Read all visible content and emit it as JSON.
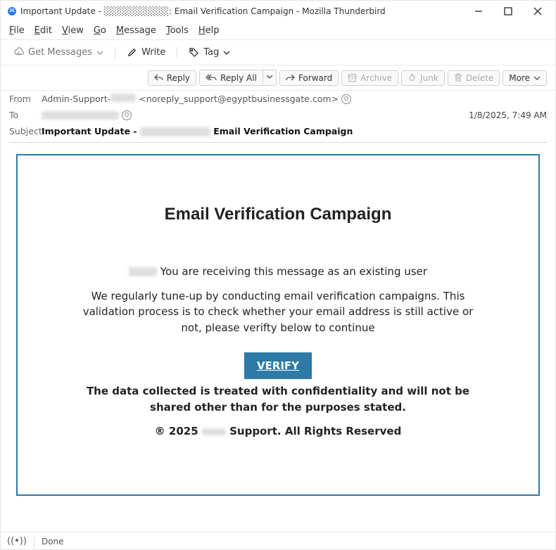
{
  "title": "Important Update - ░░░░░░░░░░: Email Verification Campaign - Mozilla Thunderbird",
  "menu": {
    "file": "File",
    "edit": "Edit",
    "view": "View",
    "go": "Go",
    "message": "Message",
    "tools": "Tools",
    "help": "Help"
  },
  "toolbar": {
    "get": "Get Messages",
    "write": "Write",
    "tag": "Tag"
  },
  "actions": {
    "reply": "Reply",
    "replyAll": "Reply All",
    "forward": "Forward",
    "archive": "Archive",
    "junk": "Junk",
    "delete": "Delete",
    "more": "More"
  },
  "headers": {
    "fromLabel": "From",
    "toLabel": "To",
    "subjectLabel": "Subject",
    "fromName": "Admin-Support-",
    "fromEmail": "<noreply_support@egyptbusinessgate.com>",
    "timestamp": "1/8/2025, 7:49 AM",
    "subjectPrefix": "Important Update - ",
    "subjectSuffix": " Email Verification Campaign"
  },
  "body": {
    "heading": "Email Verification Campaign",
    "p1suffix": " You are receiving this message as an existing user",
    "p2": "We regularly tune-up by conducting email verification campaigns. This validation process is to check whether your email address is still active or not, please verifty below to continue",
    "verify": "VERIFY",
    "disclaimer": "The data collected is treated with confidentiality and will not be shared  other  than for the purposes stated.",
    "copyPrefix": "® 2025 ",
    "copySuffix": " Support. All Rights Reserved"
  },
  "status": {
    "done": "Done"
  }
}
